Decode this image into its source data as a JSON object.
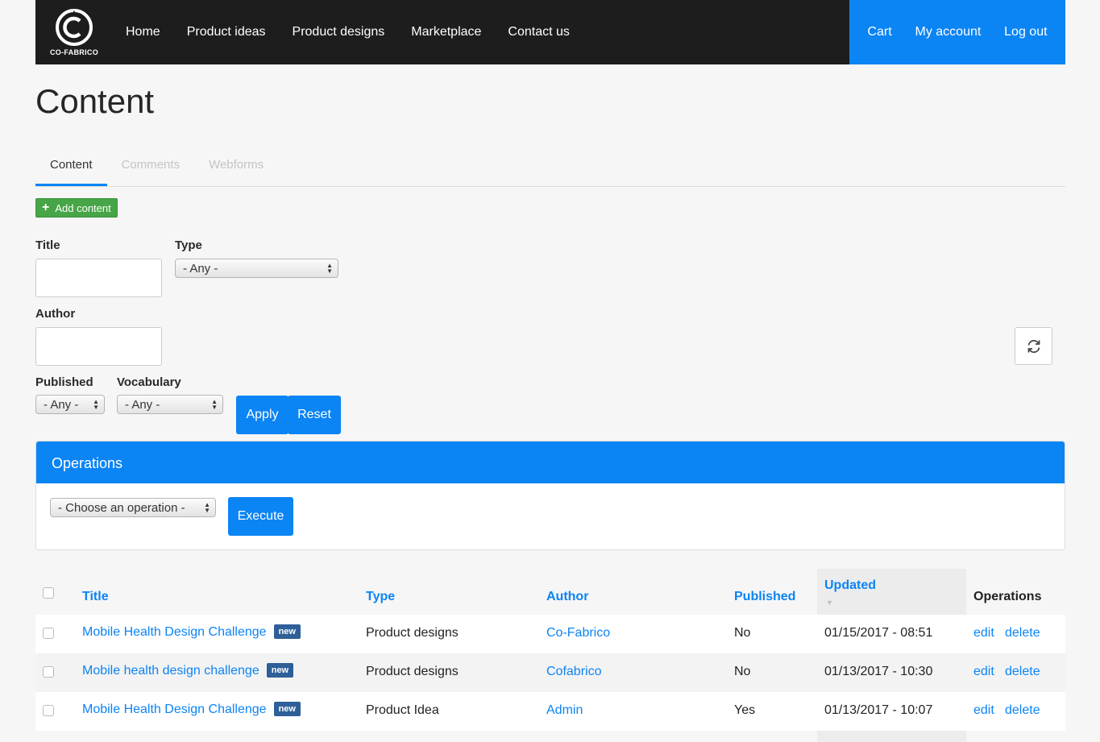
{
  "header": {
    "logo_text": "CO-FABRICO",
    "nav": [
      "Home",
      "Product ideas",
      "Product designs",
      "Marketplace",
      "Contact us"
    ],
    "account": [
      "Cart",
      "My account",
      "Log out"
    ],
    "accent_color": "#0b84f4"
  },
  "page": {
    "title": "Content"
  },
  "tabs": [
    {
      "label": "Content",
      "active": true
    },
    {
      "label": "Comments",
      "active": false
    },
    {
      "label": "Webforms",
      "active": false
    }
  ],
  "add_content_label": "Add content",
  "filters": {
    "title_label": "Title",
    "type_label": "Type",
    "type_value": "- Any -",
    "author_label": "Author",
    "published_label": "Published",
    "published_value": "- Any -",
    "vocabulary_label": "Vocabulary",
    "vocabulary_value": "- Any -",
    "apply_label": "Apply",
    "reset_label": "Reset"
  },
  "operations": {
    "title": "Operations",
    "select_value": "- Choose an operation -",
    "execute_label": "Execute"
  },
  "table": {
    "headers": {
      "title": "Title",
      "type": "Type",
      "author": "Author",
      "published": "Published",
      "updated": "Updated",
      "operations": "Operations"
    },
    "rows": [
      {
        "title": "Mobile Health Design Challenge",
        "badge": "new",
        "type": "Product designs",
        "author": "Co-Fabrico",
        "published": "No",
        "updated": "01/15/2017 - 08:51",
        "edit": "edit",
        "delete": "delete"
      },
      {
        "title": "Mobile health design challenge",
        "badge": "new",
        "type": "Product designs",
        "author": "Cofabrico",
        "published": "No",
        "updated": "01/13/2017 - 10:30",
        "edit": "edit",
        "delete": "delete"
      },
      {
        "title": "Mobile Health Design Challenge",
        "badge": "new",
        "type": "Product Idea",
        "author": "Admin",
        "published": "Yes",
        "updated": "01/13/2017 - 10:07",
        "edit": "edit",
        "delete": "delete"
      }
    ]
  }
}
